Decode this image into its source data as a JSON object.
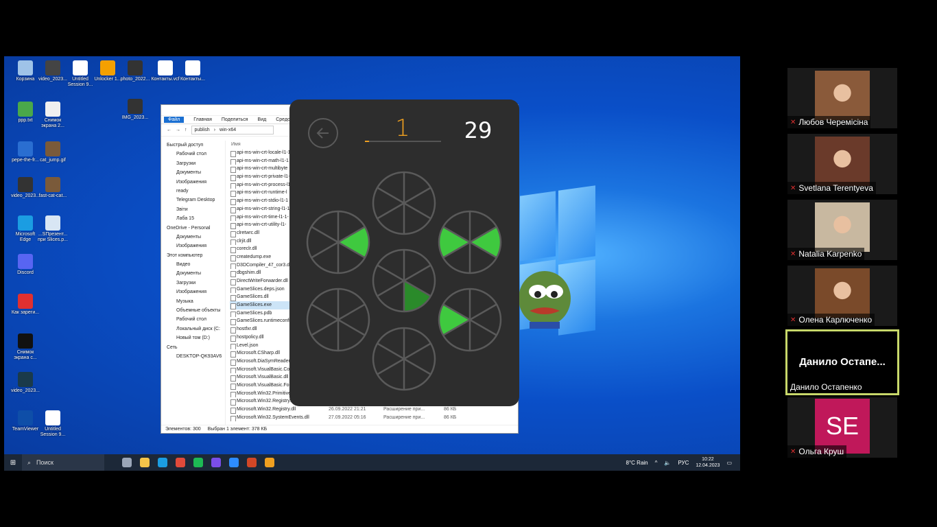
{
  "desktop_icons": [
    {
      "label": "Корзина",
      "color": "#9fc3e8"
    },
    {
      "label": "video_2023...",
      "color": "#444444"
    },
    {
      "label": "Untitled Session 9...",
      "color": "#ffffff"
    },
    {
      "label": "Unlocker 1...",
      "color": "#f4a000"
    },
    {
      "label": "photo_2022...",
      "color": "#333333"
    },
    {
      "label": "Контакты.vcf",
      "color": "#ffffff"
    },
    {
      "label": "Контакты...",
      "color": "#ffffff"
    },
    {
      "label": "ppp.txt",
      "color": "#4aa84a"
    },
    {
      "label": "Снимок экрана 2...",
      "color": "#f0f0f0"
    },
    {
      "label": "IMG_2023...",
      "color": "#333333"
    },
    {
      "label": "pepe-the-fr...",
      "color": "#2a6ed1"
    },
    {
      "label": "cat_jump.gif",
      "color": "#7a5a3a"
    },
    {
      "label": "video_2023...",
      "color": "#333333"
    },
    {
      "label": "fast-cat-cat...",
      "color": "#7a5a3a"
    },
    {
      "label": "Microsoft Edge",
      "color": "#1b9de2"
    },
    {
      "label": "...SПрезент... при Slices.p...",
      "color": "#d8e6f4"
    },
    {
      "label": "Discord",
      "color": "#5865f2"
    },
    {
      "label": "Как зареги...",
      "color": "#e03030"
    },
    {
      "label": "Снимок экрана с...",
      "color": "#111111"
    },
    {
      "label": "video_2023...",
      "color": "#1a3a4a"
    },
    {
      "label": "TeamViewer",
      "color": "#0e4ea8"
    },
    {
      "label": "Untitled Session 9...",
      "color": "#ffffff"
    }
  ],
  "explorer": {
    "ribbon": [
      "Файл",
      "Главная",
      "Поделиться",
      "Вид",
      "Средства р"
    ],
    "path": [
      "publish",
      "win-x64"
    ],
    "nav": [
      "Быстрый доступ",
      "Рабочий стол",
      "Загрузки",
      "Документы",
      "Изображения",
      "ready",
      "Telegram Desktop",
      "Звіти",
      "Лаба 15",
      "OneDrive - Personal",
      "Документы",
      "Изображения",
      "Этот компьютер",
      "Видео",
      "Документы",
      "Загрузки",
      "Изображения",
      "Музыка",
      "Объемные объекты",
      "Рабочий стол",
      "Локальный диск (C:",
      "Новый том (D:)",
      "Сеть",
      "DESKTOP-QK93AV6"
    ],
    "column_name": "Имя",
    "files": [
      {
        "name": "api-ms-win-crt-locale-l1-1"
      },
      {
        "name": "api-ms-win-crt-math-l1-1"
      },
      {
        "name": "api-ms-win-crt-multibyte"
      },
      {
        "name": "api-ms-win-crt-private-l1-"
      },
      {
        "name": "api-ms-win-crt-process-l1"
      },
      {
        "name": "api-ms-win-crt-runtime-l"
      },
      {
        "name": "api-ms-win-crt-stdio-l1-1"
      },
      {
        "name": "api-ms-win-crt-string-l1-1"
      },
      {
        "name": "api-ms-win-crt-time-l1-1-"
      },
      {
        "name": "api-ms-win-crt-utility-l1-"
      },
      {
        "name": "clretwrc.dll"
      },
      {
        "name": "clrjit.dll"
      },
      {
        "name": "coreclr.dll"
      },
      {
        "name": "createdump.exe"
      },
      {
        "name": "D3DCompiler_47_cor3.dll"
      },
      {
        "name": "dbgshim.dll"
      },
      {
        "name": "DirectWriteForwarder.dll"
      },
      {
        "name": "GameSlices.deps.json"
      },
      {
        "name": "GameSlices.dll"
      },
      {
        "name": "GameSlices.exe",
        "selected": true
      },
      {
        "name": "GameSlices.pdb"
      },
      {
        "name": "GameSlices.runtimeconfig"
      },
      {
        "name": "hostfxr.dll"
      },
      {
        "name": "hostpolicy.dll"
      },
      {
        "name": "Level.json"
      },
      {
        "name": "Microsoft.CSharp.dll"
      },
      {
        "name": "Microsoft.DiaSymReader.N"
      },
      {
        "name": "Microsoft.VisualBasic.Core"
      },
      {
        "name": "Microsoft.VisualBasic.dll"
      },
      {
        "name": "Microsoft.VisualBasic.Forr"
      },
      {
        "name": "Microsoft.Win32.Primitive"
      },
      {
        "name": "Microsoft.Win32.Registry.Ac"
      },
      {
        "name": "Microsoft.Win32.Registry.dll",
        "date": "26.09.2022 21:21",
        "type": "Расширение при...",
        "size": "86 КБ"
      },
      {
        "name": "Microsoft.Win32.SystemEvents.dll",
        "date": "27.09.2022 05:16",
        "type": "Расширение при...",
        "size": "86 КБ"
      }
    ],
    "status_count": "Элементов: 300",
    "status_selected": "Выбран 1 элемент: 378 КБ"
  },
  "game": {
    "score": "1",
    "moves": "29",
    "progress": 0.05,
    "circles": [
      {
        "pos": "top",
        "filled": []
      },
      {
        "pos": "left-upper",
        "filled": [
          0
        ]
      },
      {
        "pos": "right-upper",
        "filled": [
          0,
          3
        ]
      },
      {
        "pos": "center",
        "filled": [
          1
        ]
      },
      {
        "pos": "left-lower",
        "filled": []
      },
      {
        "pos": "right-lower",
        "filled": [
          3
        ]
      },
      {
        "pos": "bottom",
        "filled": []
      }
    ],
    "colors": {
      "slice": "#3fc93f",
      "slice_dark": "#2a8a2a",
      "stroke": "#5a5a5a",
      "highlight": "#c0402a"
    }
  },
  "taskbar": {
    "search": "Поиск",
    "weather": "8°C Rain",
    "lang": "РУС",
    "time": "10:22",
    "date": "12.04.2023",
    "apps": [
      {
        "name": "task-view",
        "color": "#9aa6b8"
      },
      {
        "name": "file-explorer",
        "color": "#f4c44a"
      },
      {
        "name": "edge",
        "color": "#1b9de2"
      },
      {
        "name": "chrome",
        "color": "#e04a3a"
      },
      {
        "name": "spotify",
        "color": "#1db954"
      },
      {
        "name": "messenger",
        "color": "#7a4ee8"
      },
      {
        "name": "zoom",
        "color": "#2d8cff"
      },
      {
        "name": "powerpoint",
        "color": "#d24726"
      },
      {
        "name": "game-slices",
        "color": "#f0a020"
      }
    ]
  },
  "participants": [
    {
      "name": "Любов Черемісіна",
      "muted": true,
      "face": "#8a5a3a"
    },
    {
      "name": "Svetlana Terentyeva",
      "muted": true,
      "face": "#6a3a2a"
    },
    {
      "name": "Natalia Karpenko",
      "muted": true,
      "face": "#c8b8a0"
    },
    {
      "name": "Олена Карлюченко",
      "muted": true,
      "face": "#7a4a2a"
    },
    {
      "name": "Данило Остапенко",
      "muted": false,
      "active": true,
      "big": "Данило  Остапе..."
    },
    {
      "name": "Ольга Круш",
      "muted": true,
      "initials": "SE"
    }
  ]
}
